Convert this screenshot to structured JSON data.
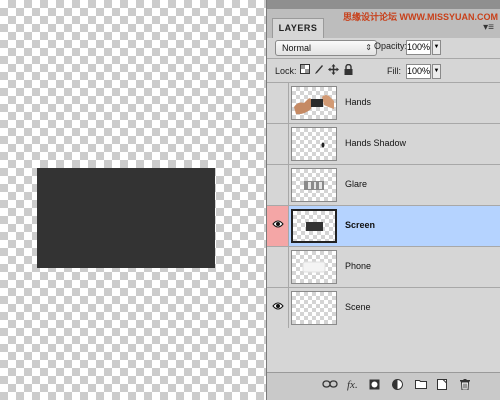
{
  "panel": {
    "tab_label": "LAYERS",
    "menu_icon": "panel-menu-icon",
    "watermark": "思缘设计论坛 WWW.MISSYUAN.COM"
  },
  "blend": {
    "mode": "Normal",
    "opacity_label": "Opacity:",
    "opacity_value": "100%"
  },
  "lock": {
    "label": "Lock:",
    "fill_label": "Fill:",
    "fill_value": "100%",
    "icons": [
      "lock-transparent-icon",
      "lock-image-icon",
      "lock-position-icon",
      "lock-all-icon"
    ]
  },
  "layers": [
    {
      "name": "Hands",
      "visible": false,
      "selected": false
    },
    {
      "name": "Hands Shadow",
      "visible": false,
      "selected": false
    },
    {
      "name": "Glare",
      "visible": false,
      "selected": false
    },
    {
      "name": "Screen",
      "visible": true,
      "selected": true
    },
    {
      "name": "Phone",
      "visible": false,
      "selected": false
    },
    {
      "name": "Scene",
      "visible": true,
      "selected": false
    }
  ],
  "footer_icons": [
    "link-layers-icon",
    "fx-icon",
    "layer-mask-icon",
    "adjustment-layer-icon",
    "new-group-icon",
    "new-layer-icon",
    "trash-icon"
  ],
  "colors": {
    "selection": "#b5d3ff",
    "eye_highlight": "#f4a6a6",
    "screen_fill": "#333333"
  }
}
